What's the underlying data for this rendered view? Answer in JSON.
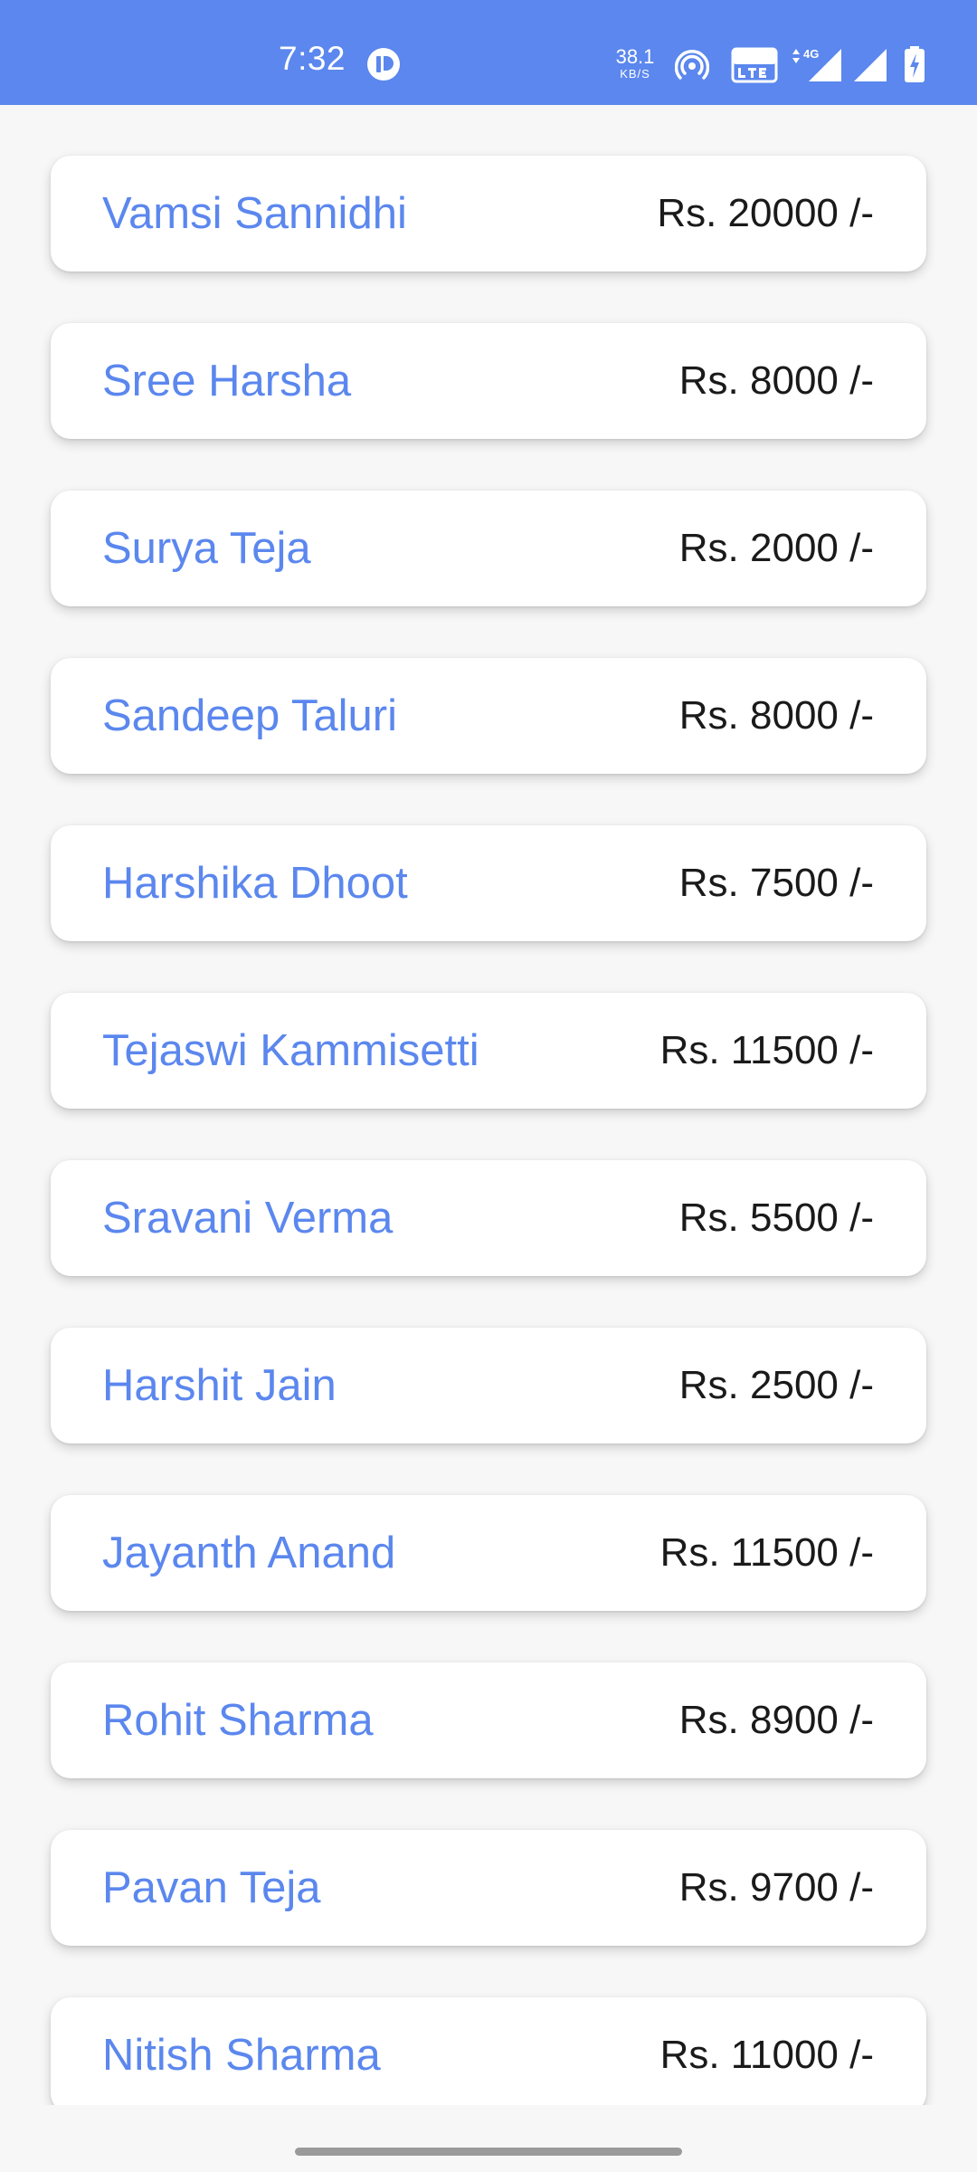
{
  "status_bar": {
    "time": "7:32",
    "net_speed_value": "38.1",
    "net_speed_unit": "KB/S",
    "icons": [
      "app-notification-icon",
      "hotspot-icon",
      "volte-icon",
      "4g-data-icon",
      "signal-icon",
      "signal-icon-2",
      "battery-charging-icon"
    ],
    "background_color": "#5b87ee"
  },
  "list": {
    "name_color": "#5b87ee",
    "items": [
      {
        "name": "Vamsi Sannidhi",
        "amount": "Rs. 20000 /-"
      },
      {
        "name": "Sree Harsha",
        "amount": "Rs. 8000 /-"
      },
      {
        "name": "Surya Teja",
        "amount": "Rs. 2000 /-"
      },
      {
        "name": "Sandeep Taluri",
        "amount": "Rs. 8000 /-"
      },
      {
        "name": "Harshika Dhoot",
        "amount": "Rs. 7500 /-"
      },
      {
        "name": "Tejaswi Kammisetti",
        "amount": "Rs. 11500 /-"
      },
      {
        "name": "Sravani Verma",
        "amount": "Rs. 5500 /-"
      },
      {
        "name": "Harshit Jain",
        "amount": "Rs. 2500 /-"
      },
      {
        "name": "Jayanth Anand",
        "amount": "Rs. 11500 /-"
      },
      {
        "name": "Rohit Sharma",
        "amount": "Rs. 8900 /-"
      },
      {
        "name": "Pavan Teja",
        "amount": "Rs. 9700 /-"
      },
      {
        "name": "Nitish Sharma",
        "amount": "Rs. 11000 /-"
      }
    ]
  }
}
